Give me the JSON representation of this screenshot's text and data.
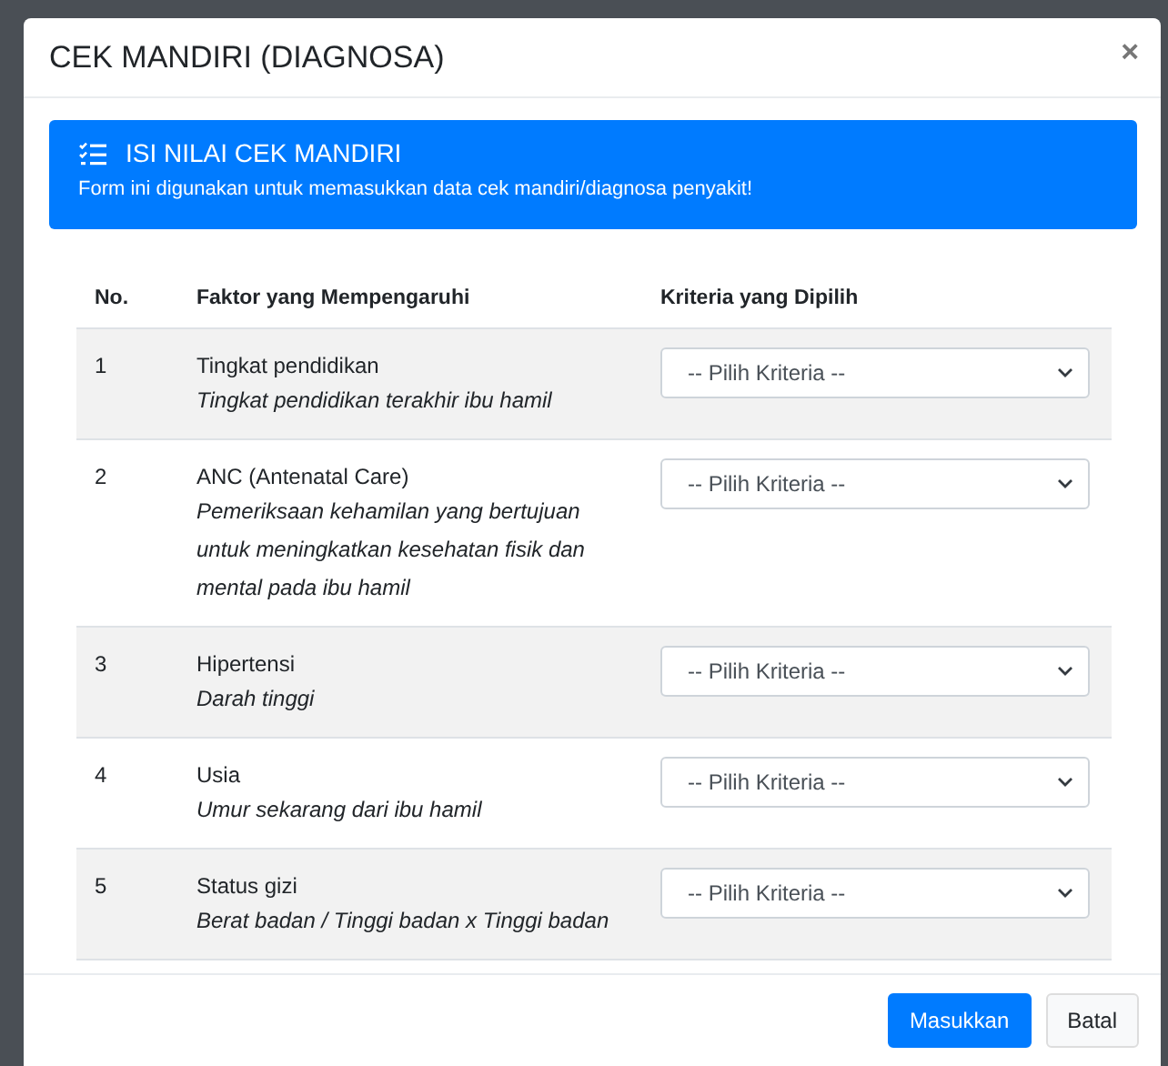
{
  "modal": {
    "title": "CEK MANDIRI (DIAGNOSA)",
    "close": "×"
  },
  "alert": {
    "heading": "ISI NILAI CEK MANDIRI",
    "text": "Form ini digunakan untuk memasukkan data cek mandiri/diagnosa penyakit!"
  },
  "table": {
    "columns": [
      "No.",
      "Faktor yang Mempengaruhi",
      "Kriteria yang Dipilih"
    ],
    "rows": [
      {
        "no": "1",
        "factor": "Tingkat pendidikan",
        "description": "Tingkat pendidikan terakhir ibu hamil",
        "select": "-- Pilih Kriteria --"
      },
      {
        "no": "2",
        "factor": "ANC (Antenatal Care)",
        "description": "Pemeriksaan kehamilan yang bertujuan untuk meningkatkan kesehatan fisik dan mental pada ibu hamil",
        "select": "-- Pilih Kriteria --"
      },
      {
        "no": "3",
        "factor": "Hipertensi",
        "description": "Darah tinggi",
        "select": "-- Pilih Kriteria --"
      },
      {
        "no": "4",
        "factor": "Usia",
        "description": "Umur sekarang dari ibu hamil",
        "select": "-- Pilih Kriteria --"
      },
      {
        "no": "5",
        "factor": "Status gizi",
        "description": "Berat badan / Tinggi badan x Tinggi badan",
        "select": "-- Pilih Kriteria --"
      }
    ]
  },
  "buttons": [
    {
      "label": "Masukkan",
      "kind": "primary"
    },
    {
      "label": "Batal",
      "kind": "secondary"
    }
  ]
}
